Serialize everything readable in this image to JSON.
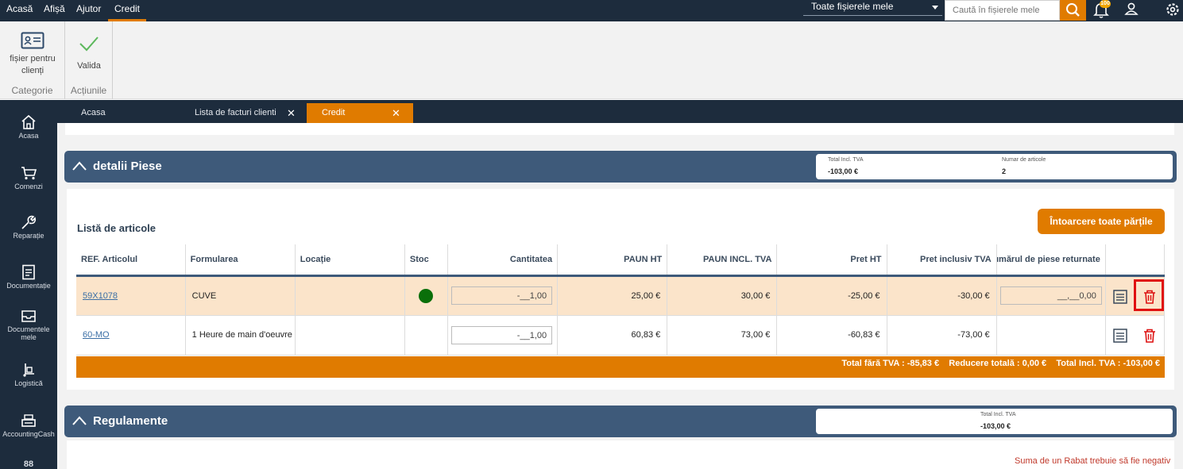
{
  "topnav": {
    "menus": [
      "Acasă",
      "Afișă",
      "Ajutor",
      "Credit"
    ],
    "file_select": "Toate fișierele mele",
    "search_placeholder": "Caută în fișierele mele",
    "notif_count": "100"
  },
  "ribbon": {
    "client_file_label": "fișier pentru clienți",
    "category_label": "Categorie",
    "validate_label": "Valida",
    "actions_label": "Acțiunile"
  },
  "sidebar": {
    "items": [
      "Acasa",
      "Comenzi",
      "Reparație",
      "Documentație",
      "Documentele mele",
      "Logistică",
      "AccountingCash"
    ]
  },
  "tabs": {
    "home": "Acasa",
    "invoices": "Lista de facturi clienti",
    "credit": "Credit"
  },
  "parts": {
    "title": "detalii Piese",
    "total_caption": "Total Incl. TVA",
    "total_value": "-103,00 €",
    "count_caption": "Numar de articole",
    "count_value": "2",
    "list_title": "Listă de articole",
    "return_all_button": "Întoarcere toate părțile",
    "columns": [
      "REF. Articolul",
      "Formularea",
      "Locație",
      "Stoc",
      "Cantitatea",
      "PAUN HT",
      "PAUN INCL. TVA",
      "Pret HT",
      "Pret inclusiv TVA",
      "Numărul de piese returnate"
    ],
    "rows": [
      {
        "ref": "59X1078",
        "label": "CUVE",
        "location": "",
        "qty": "-__1,00",
        "paun_ht": "25,00 €",
        "paun_ttc": "30,00 €",
        "price_ht": "-25,00 €",
        "price_ttc": "-30,00 €",
        "returned": "__,__0,00"
      },
      {
        "ref": "60-MO",
        "label": "1 Heure de main d'oeuvre",
        "location": "",
        "qty": "-__1,00",
        "paun_ht": "60,83 €",
        "paun_ttc": "73,00 €",
        "price_ht": "-60,83 €",
        "price_ttc": "-73,00 €",
        "returned": ""
      }
    ],
    "footer": "Total fără TVA : -85,83 €    Reducere totală : 0,00 €    Total Incl. TVA : -103,00 €"
  },
  "payments": {
    "title": "Regulamente",
    "total_caption": "Total Incl. TVA",
    "total_value": "-103,00 €",
    "warning": "Suma de un Rabat trebuie să fie negativ"
  },
  "colors": {
    "nav": "#1d2c3d",
    "accent": "#e07b00",
    "section": "#3e5a7a",
    "highlight_row": "#fbe4ca"
  }
}
